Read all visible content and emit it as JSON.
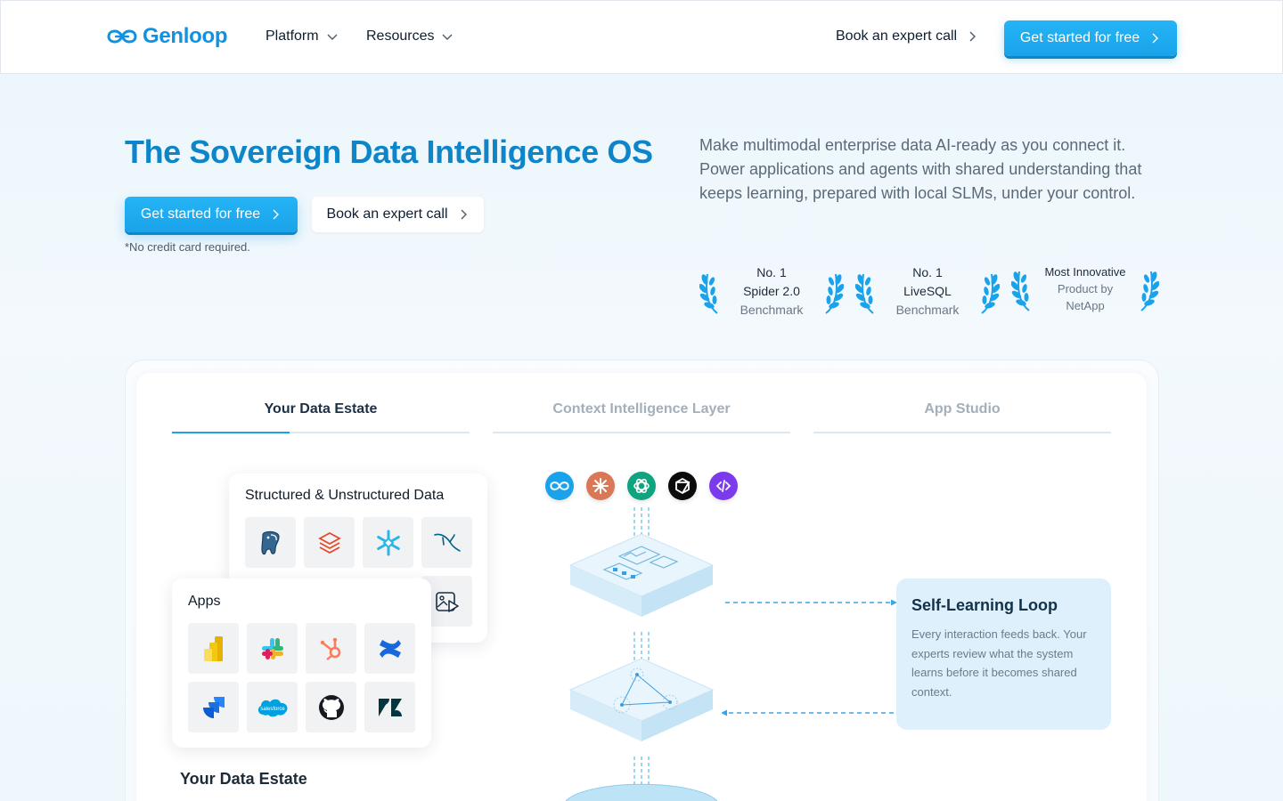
{
  "header": {
    "logo_text": "Genloop",
    "nav": [
      {
        "label": "Platform"
      },
      {
        "label": "Resources"
      }
    ],
    "book_call": "Book an expert call",
    "cta": "Get started for free"
  },
  "hero": {
    "title": "The Sovereign Data Intelligence OS",
    "cta_primary": "Get started for free",
    "cta_secondary": "Book an expert call",
    "note": "*No credit card required.",
    "description": "Make multimodal enterprise data AI-ready as you connect it. Power applications and agents with shared understanding that keeps learning, prepared with local SLMs, under your control."
  },
  "awards": [
    {
      "line1": "No. 1",
      "line2": "Spider 2.0",
      "line3": "Benchmark"
    },
    {
      "line1": "No. 1",
      "line2": "LiveSQL",
      "line3": "Benchmark"
    },
    {
      "line1": "Most Innovative",
      "line2": "Product by",
      "line3": "NetApp"
    }
  ],
  "tabs": [
    {
      "label": "Your Data Estate",
      "active": true
    },
    {
      "label": "Context Intelligence Layer",
      "active": false
    },
    {
      "label": "App Studio",
      "active": false
    }
  ],
  "data_card": {
    "title": "Structured & Unstructured Data",
    "icons": [
      "postgresql-icon",
      "databricks-icon",
      "snowflake-icon",
      "mysql-icon",
      "image-video-icon"
    ]
  },
  "apps_card": {
    "title": "Apps",
    "icons": [
      "power-bi-icon",
      "slack-icon",
      "hubspot-icon",
      "confluence-icon",
      "jira-icon",
      "salesforce-icon",
      "github-icon",
      "zendesk-icon"
    ],
    "salesforce_label": "salesforce"
  },
  "estate_label": "Your Data Estate",
  "ai_models": [
    "genloop-icon",
    "claude-icon",
    "openai-icon",
    "cursor-icon",
    "code-icon"
  ],
  "loop": {
    "title": "Self-Learning Loop",
    "description": "Every interaction feeds back. Your experts review what the system learns before it becomes shared context."
  },
  "colors": {
    "brand": "#1192e0",
    "cta": "#1aa3ea",
    "title": "#0e85c9",
    "loop_bg": "#def0fb"
  }
}
